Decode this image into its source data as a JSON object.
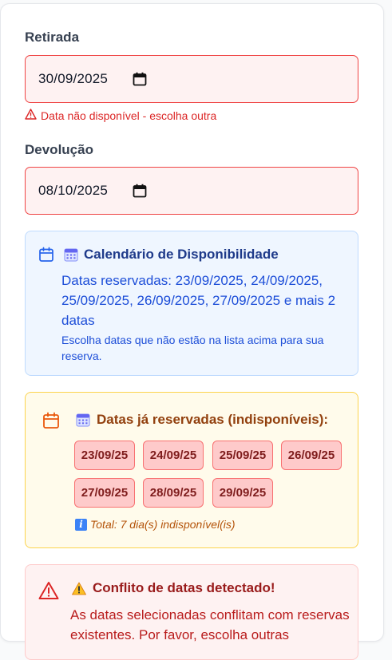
{
  "pickup": {
    "label": "Retirada",
    "value": "30/09/2025",
    "error": "Data não disponível - escolha outra"
  },
  "return": {
    "label": "Devolução",
    "value": "08/10/2025"
  },
  "availability": {
    "icon": "calendar-icon",
    "title": "Calendário de Disponibilidade",
    "reserved_text": "Datas reservadas: 23/09/2025, 24/09/2025, 25/09/2025, 26/09/2025, 27/09/2025 e mais 2 datas",
    "hint": "Escolha datas que não estão na lista acima para sua reserva."
  },
  "reserved": {
    "icon": "calendar-icon",
    "title": "Datas já reservadas (indisponíveis):",
    "chips": [
      "23/09/25",
      "24/09/25",
      "25/09/25",
      "26/09/25",
      "27/09/25",
      "28/09/25",
      "29/09/25"
    ],
    "total": "Total: 7 dia(s) indisponível(is)"
  },
  "conflict": {
    "icon": "warning-icon",
    "title": "Conflito de datas detectado!",
    "message": "As datas selecionadas conflitam com reservas existentes. Por favor, escolha outras"
  },
  "colors": {
    "error": "#dc2626",
    "info_bg": "#eff6ff",
    "warn_bg": "#fffbeb",
    "chip_bg": "#fecaca",
    "conflict_bg": "#fef2f2"
  }
}
